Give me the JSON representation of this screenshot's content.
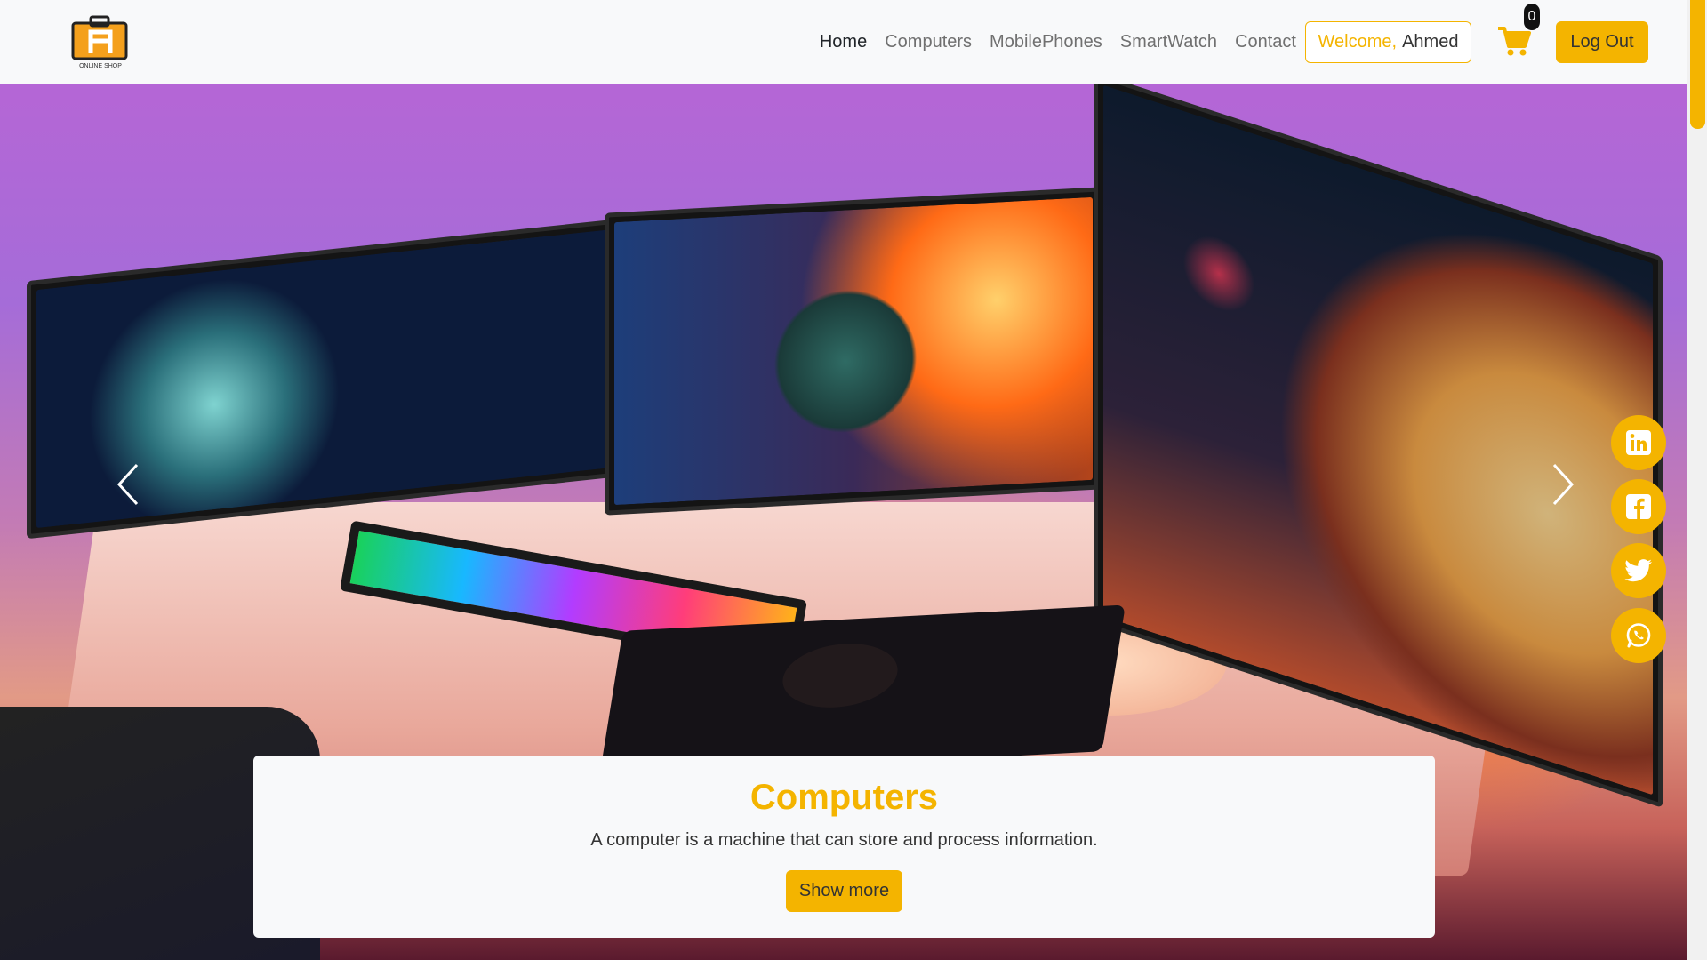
{
  "brand": {
    "logo_text": "ONLINE SHOP"
  },
  "nav": {
    "links": [
      "Home",
      "Computers",
      "MobilePhones",
      "SmartWatch",
      "Contact"
    ],
    "welcome_label": "Welcome,",
    "user_name": "Ahmed",
    "cart_count": "0",
    "logout_label": "Log Out"
  },
  "hero": {
    "title": "Computers",
    "description": "A computer is a machine that can store and process information.",
    "button_label": "Show more"
  },
  "social": [
    "linkedin-icon",
    "facebook-icon",
    "twitter-icon",
    "whatsapp-icon"
  ],
  "colors": {
    "accent": "#f4b400",
    "navbar": "#f8f9fa",
    "text": "#333333"
  }
}
